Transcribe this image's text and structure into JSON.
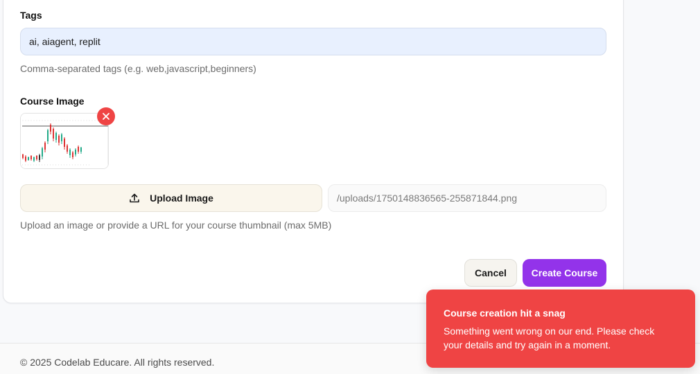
{
  "form": {
    "tags": {
      "label": "Tags",
      "value": "ai, aiagent, replit",
      "help": "Comma-separated tags (e.g. web,javascript,beginners)"
    },
    "course_image": {
      "label": "Course Image",
      "upload_label": "Upload Image",
      "url_value": "/uploads/1750148836565-255871844.png",
      "help": "Upload an image or provide a URL for your course thumbnail (max 5MB)"
    },
    "actions": {
      "cancel_label": "Cancel",
      "create_label": "Create Course"
    }
  },
  "footer": {
    "text": "© 2025 Codelab Educare. All rights reserved."
  },
  "toast": {
    "title": "Course creation hit a snag",
    "message": "Something went wrong on our end. Please check your details and try again in a moment."
  },
  "colors": {
    "accent": "#9333ea",
    "error": "#ef4444",
    "tags_input_bg": "#e8f0fe"
  },
  "icons": {
    "remove": "close-icon",
    "upload": "upload-icon"
  }
}
